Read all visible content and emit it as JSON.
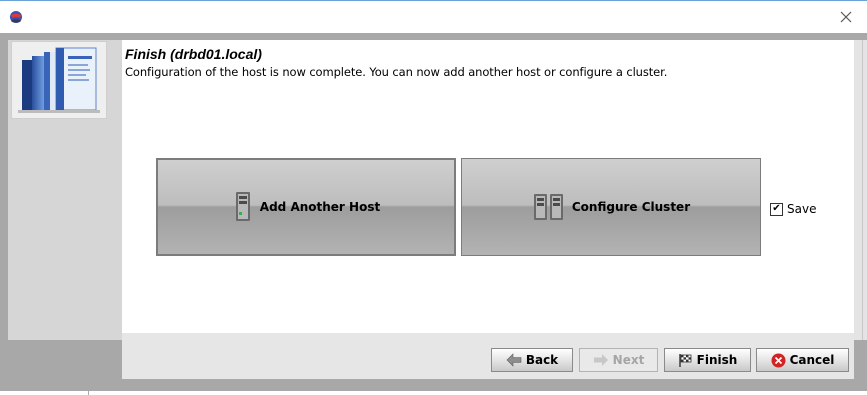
{
  "window": {
    "app_icon": "globe-icon",
    "close_icon": "close-icon"
  },
  "page": {
    "title": "Finish (drbd01.local)",
    "description": "Configuration of the host is now complete. You can now add another host or configure a cluster."
  },
  "actions": {
    "add_host": {
      "label": "Add Another Host",
      "icon": "server-icon"
    },
    "configure_cluster": {
      "label": "Configure Cluster",
      "icon": "cluster-icon"
    }
  },
  "save": {
    "label": "Save",
    "checked": true
  },
  "nav": {
    "back": "Back",
    "next": "Next",
    "finish": "Finish",
    "cancel": "Cancel"
  },
  "colors": {
    "frame": "#a8a8a8",
    "button_face": "#bdbdbd",
    "cancel_icon": "#d22222",
    "disabled_text": "#a5a5a5"
  }
}
